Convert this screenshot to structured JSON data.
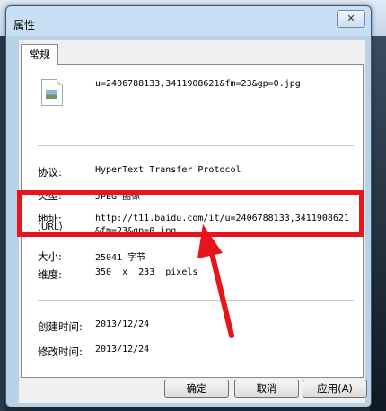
{
  "window": {
    "title": "属性",
    "close_label": "✕"
  },
  "tabs": [
    {
      "label": "常规"
    }
  ],
  "file": {
    "name": "u=2406788133,3411908621&fm=23&gp=0.jpg"
  },
  "properties": {
    "protocol_label": "协议:",
    "protocol_value": "HyperText Transfer Protocol",
    "type_label": "类型:",
    "type_value": "JPEG 图像",
    "address_label": "地址:",
    "address_sublabel": "(URL)",
    "address_line1": "http://t11.baidu.com/it/u=2406788133,3411908621",
    "address_line2": "&fm=23&gp=0.jpg",
    "size_label": "大小:",
    "size_value": "25041 字节",
    "dimensions_label": "维度:",
    "dimensions_value": "350  x  233  pixels",
    "created_label": "创建时间:",
    "created_value": "2013/12/24",
    "modified_label": "修改时间:",
    "modified_value": "2013/12/24"
  },
  "buttons": {
    "ok": "确定",
    "cancel": "取消",
    "apply": "应用(A)"
  },
  "colors": {
    "annotation": "#e8141b"
  }
}
